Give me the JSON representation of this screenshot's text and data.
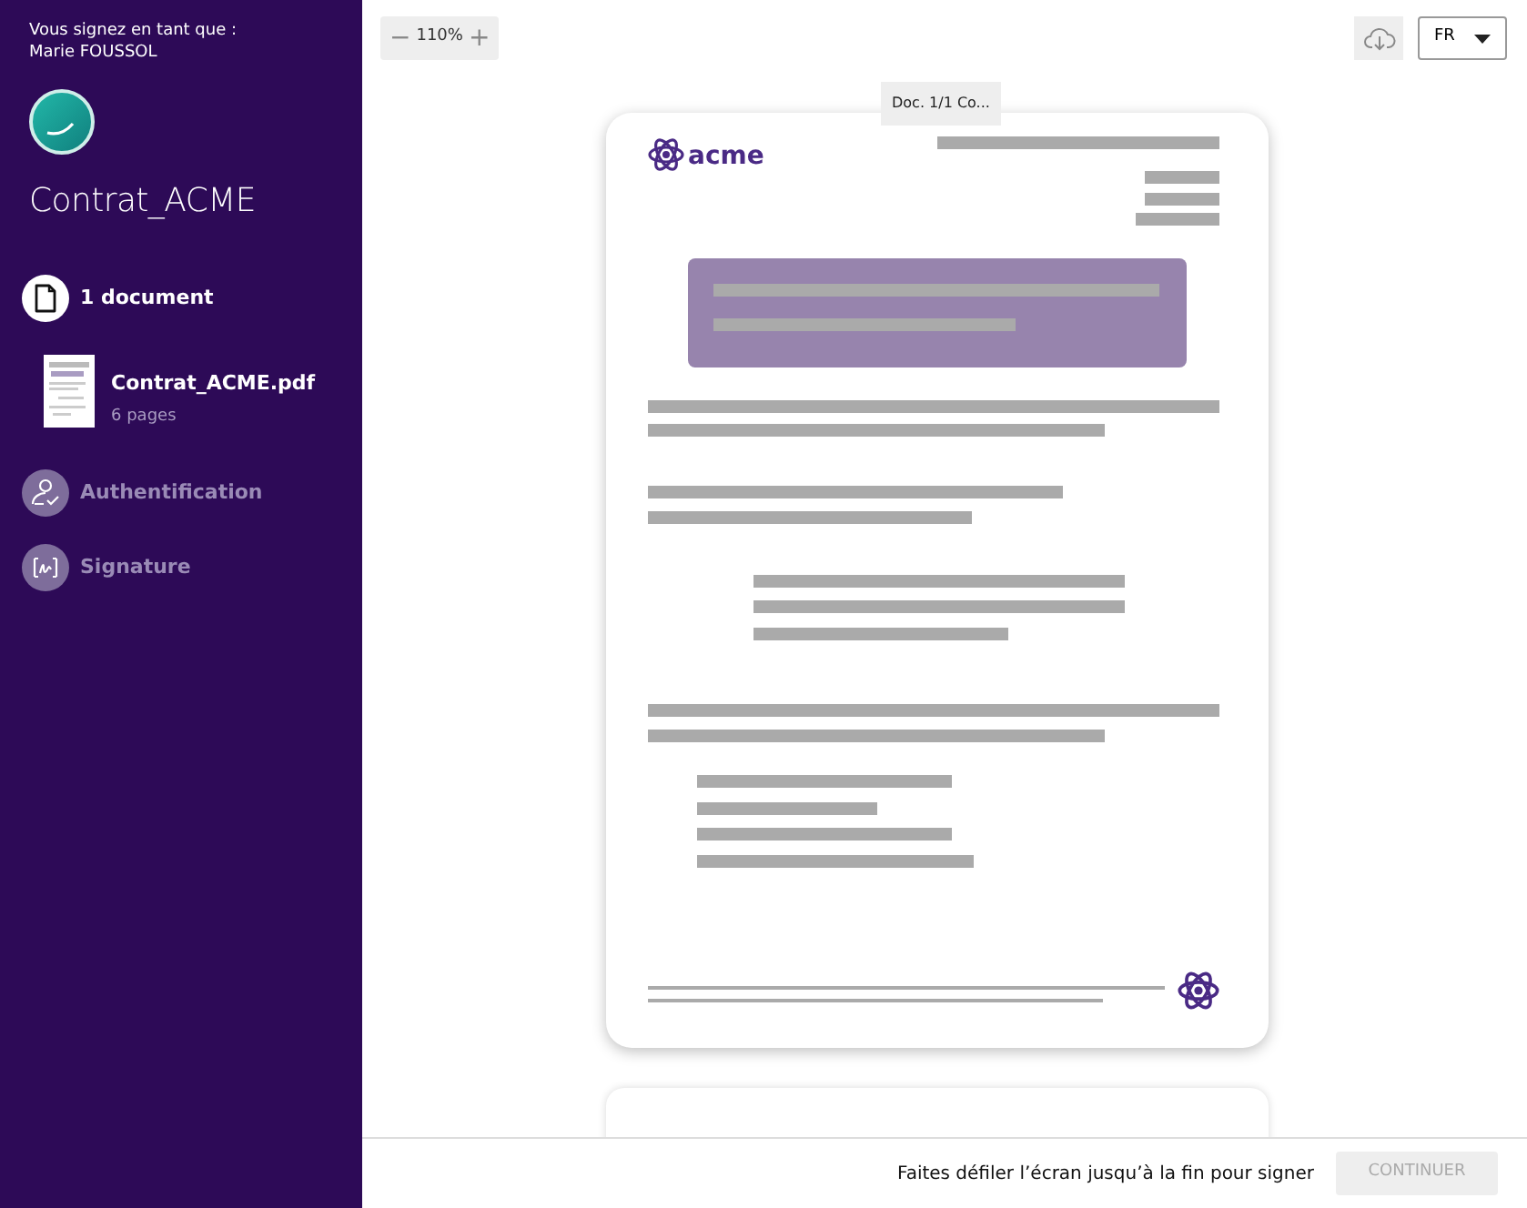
{
  "signer": {
    "label": "Vous signez en tant que :",
    "name": "Marie FOUSSOL"
  },
  "envelope_title": "Contrat_ACME",
  "steps": [
    {
      "kind": "documents",
      "label": "1 document",
      "active": true,
      "documents": [
        {
          "name": "Contrat_ACME.pdf",
          "pages": "6 pages"
        }
      ]
    },
    {
      "kind": "authentication",
      "label": "Authentification",
      "active": false
    },
    {
      "kind": "signature",
      "label": "Signature",
      "active": false
    }
  ],
  "toolbar": {
    "zoom_out": "−",
    "zoom": "110%",
    "zoom_in": "+",
    "document_tab": "Doc. 1/1 Co...",
    "language": "FR"
  },
  "document": {
    "logo_text": "acme"
  },
  "footer": {
    "hint": "Faites défiler l’écran jusqu’à la fin pour signer",
    "button": {
      "label": "CONTINUER",
      "disabled": true
    }
  }
}
